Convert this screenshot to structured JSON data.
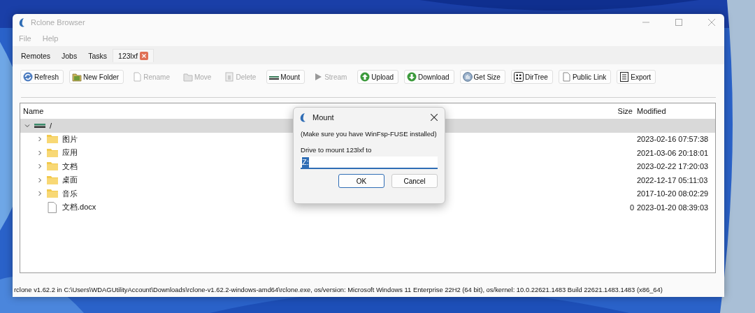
{
  "window": {
    "title": "Rclone Browser"
  },
  "menu": [
    "File",
    "Help"
  ],
  "tabs": [
    {
      "label": "Remotes",
      "selected": false,
      "closable": false
    },
    {
      "label": "Jobs",
      "selected": false,
      "closable": false
    },
    {
      "label": "Tasks",
      "selected": false,
      "closable": false
    },
    {
      "label": "123lxf",
      "selected": true,
      "closable": true
    }
  ],
  "toolbar": [
    {
      "label": "Refresh",
      "kind": "refresh",
      "disabled": false
    },
    {
      "label": "New Folder",
      "kind": "newfolder",
      "disabled": false
    },
    {
      "label": "Rename",
      "kind": "rename",
      "disabled": true
    },
    {
      "label": "Move",
      "kind": "move",
      "disabled": true
    },
    {
      "label": "Delete",
      "kind": "delete",
      "disabled": true
    },
    {
      "label": "Mount",
      "kind": "mount",
      "disabled": false
    },
    {
      "label": "Stream",
      "kind": "stream",
      "disabled": true
    },
    {
      "label": "Upload",
      "kind": "upload",
      "disabled": false
    },
    {
      "label": "Download",
      "kind": "download",
      "disabled": false
    },
    {
      "label": "Get Size",
      "kind": "getsize",
      "disabled": false
    },
    {
      "label": "DirTree",
      "kind": "dirtree",
      "disabled": false
    },
    {
      "label": "Public Link",
      "kind": "publiclink",
      "disabled": false
    },
    {
      "label": "Export",
      "kind": "export",
      "disabled": false
    }
  ],
  "tree": {
    "columns": [
      "Name",
      "Size",
      "Modified"
    ],
    "rows": [
      {
        "name": "/",
        "kind": "drive",
        "expanded": true,
        "selected": true,
        "children": [
          {
            "name": "图片",
            "kind": "folder",
            "expanded": false,
            "selected": false,
            "modified": "2023-02-16 07:57:38"
          },
          {
            "name": "应用",
            "kind": "folder",
            "expanded": false,
            "selected": false,
            "modified": "2021-03-06 20:18:01"
          },
          {
            "name": "文档",
            "kind": "folder",
            "expanded": false,
            "selected": false,
            "modified": "2023-02-22 17:20:03"
          },
          {
            "name": "桌面",
            "kind": "folder",
            "expanded": false,
            "selected": false,
            "modified": "2022-12-17 05:11:03"
          },
          {
            "name": "音乐",
            "kind": "folder",
            "expanded": false,
            "selected": false,
            "modified": "2017-10-20 08:02:29"
          },
          {
            "name": "文档.docx",
            "kind": "file",
            "selected": false,
            "size": "0",
            "modified": "2023-01-20 08:39:03"
          }
        ]
      }
    ]
  },
  "dialog": {
    "title": "Mount",
    "note": "(Make sure you have WinFsp-FUSE installed)",
    "label": "Drive to mount 123lxf to",
    "value": "Z:",
    "buttons": [
      {
        "label": "OK",
        "default": true
      },
      {
        "label": "Cancel",
        "default": false
      }
    ]
  },
  "status_bar": "rclone v1.62.2 in C:\\Users\\WDAGUtilityAccount\\Downloads\\rclone-v1.62.2-windows-amd64\\rclone.exe, os/version: Microsoft Windows 11 Enterprise 22H2 (64 bit), os/kernel: 10.0.22621.1483 Build 22621.1483.1483 (x86_64)"
}
